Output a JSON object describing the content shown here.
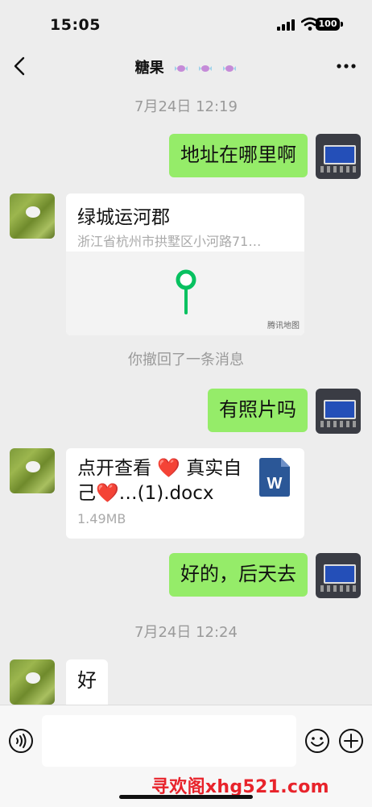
{
  "status_bar": {
    "time": "15:05",
    "battery": "100"
  },
  "nav": {
    "title": "糖果"
  },
  "messages": {
    "ts1": "7月24日 12:19",
    "m1": "地址在哪里啊",
    "location": {
      "name": "绿城运河郡",
      "address": "浙江省杭州市拱墅区小河路71…",
      "map_label": "腾讯地图"
    },
    "recall": "你撤回了一条消息",
    "m2": "有照片吗",
    "file": {
      "name": "点开查看 ❤️ 真实自己❤️…(1).docx",
      "size": "1.49MB"
    },
    "m3": "好的，后天去",
    "ts2": "7月24日 12:24",
    "m4": "好"
  },
  "watermark": "寻欢阁xhg521.com",
  "colors": {
    "self_bubble": "#95ec69",
    "other_bubble": "#ffffff",
    "background": "#ededed",
    "word_icon": "#2b5797",
    "pin": "#07c160"
  }
}
